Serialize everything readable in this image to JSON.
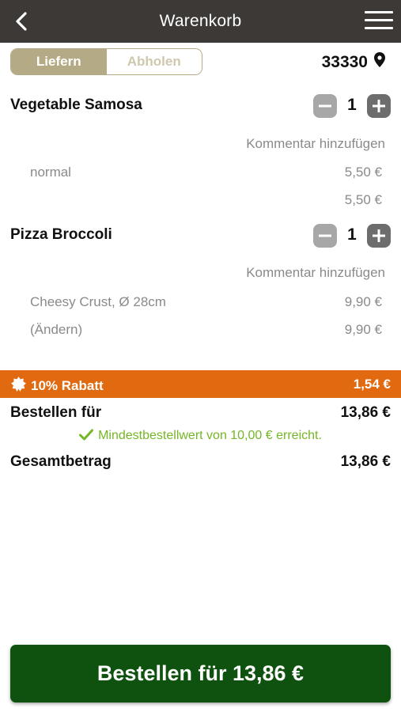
{
  "header": {
    "title": "Warenkorb"
  },
  "mode": {
    "deliver_label": "Liefern",
    "pickup_label": "Abholen"
  },
  "zip": "33330",
  "items": [
    {
      "name": "Vegetable Samosa",
      "qty": "1",
      "comment_label": "Kommentar hinzufügen",
      "options": [
        {
          "label": "normal",
          "price": "5,50 €"
        }
      ],
      "total": "5,50 €"
    },
    {
      "name": "Pizza Broccoli",
      "qty": "1",
      "comment_label": "Kommentar hinzufügen",
      "options": [
        {
          "label": "Cheesy Crust, Ø 28cm",
          "price": "9,90 €"
        },
        {
          "label": "(Ändern)",
          "price": "9,90 €"
        }
      ]
    }
  ],
  "discount": {
    "label": "10% Rabatt",
    "value": "1,54 €"
  },
  "subtotal": {
    "label": "Bestellen für",
    "value": "13,86 €"
  },
  "min_order_text": "Mindestbestellwert von 10,00 € erreicht.",
  "grand_total": {
    "label": "Gesamtbetrag",
    "value": "13,86 €"
  },
  "order_button": {
    "label": "Bestellen für 13,86 €"
  },
  "colors": {
    "header_bg": "#3d3937",
    "toggle_active": "#b4ab86",
    "discount_bg": "#e1690f",
    "success_green": "#74b626",
    "order_button_bg": "#0f520f"
  },
  "icons": [
    "back-arrow-icon",
    "hamburger-menu-icon",
    "location-pin-icon",
    "minus-icon",
    "plus-icon",
    "discount-badge-icon",
    "checkmark-icon"
  ]
}
